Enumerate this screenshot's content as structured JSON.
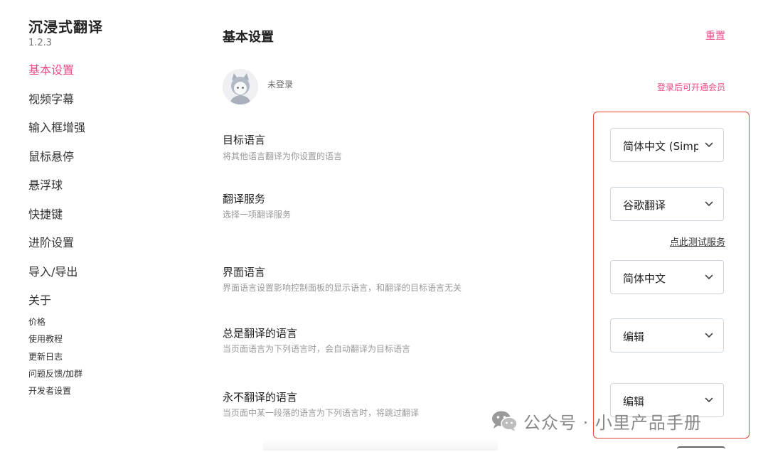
{
  "sidebar": {
    "app_title": "沉浸式翻译",
    "version": "1.2.3",
    "nav_items": [
      {
        "label": "基本设置",
        "active": true
      },
      {
        "label": "视频字幕"
      },
      {
        "label": "输入框增强"
      },
      {
        "label": "鼠标悬停"
      },
      {
        "label": "悬浮球"
      },
      {
        "label": "快捷键"
      },
      {
        "label": "进阶设置"
      },
      {
        "label": "导入/导出"
      },
      {
        "label": "关于"
      }
    ],
    "sub_items": [
      {
        "label": "价格"
      },
      {
        "label": "使用教程"
      },
      {
        "label": "更新日志"
      },
      {
        "label": "问题反馈/加群"
      },
      {
        "label": "开发者设置"
      }
    ]
  },
  "header": {
    "title": "基本设置",
    "reset_label": "重置"
  },
  "account": {
    "status": "未登录",
    "vip_link": "登录后可开通会员",
    "avatar_icon": "user-avatar-icon"
  },
  "settings": {
    "target_language": {
      "label": "目标语言",
      "description": "将其他语言翻译为你设置的语言",
      "value": "简体中文 (Simplified Chinese)"
    },
    "translation_service": {
      "label": "翻译服务",
      "description": "选择一项翻译服务",
      "value": "谷歌翻译",
      "test_link": "点此测试服务"
    },
    "interface_language": {
      "label": "界面语言",
      "description": "界面语言设置影响控制面板的显示语言，和翻译的目标语言无关",
      "value": "简体中文"
    },
    "always_translate": {
      "label": "总是翻译的语言",
      "description": "当页面语言为下列语言时，会自动翻译为目标语言",
      "value": "编辑"
    },
    "never_translate": {
      "label": "永不翻译的语言",
      "description": "当页面中某一段落的语言为下列语言时，将跳过翻译",
      "value": "编辑"
    }
  },
  "watermark": {
    "text": "公众号 · 小里产品手册",
    "icon": "wechat-icon"
  },
  "colors": {
    "accent": "#ea4c89",
    "highlight_border": "#e8433a",
    "muted_text": "#999999"
  }
}
